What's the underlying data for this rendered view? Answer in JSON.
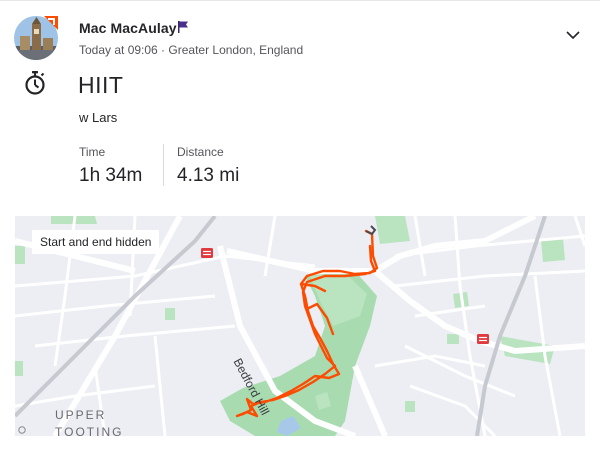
{
  "athlete": {
    "name": "Mac MacAulay",
    "avatar_icon": "avatar-photo",
    "badge_icon": "strava-badge-icon",
    "flag_icon": "flag-icon",
    "meta": "Today at 09:06 · Greater London, England"
  },
  "controls": {
    "expand_icon": "chevron-down-icon"
  },
  "activity": {
    "type_icon": "stopwatch-icon",
    "title": "HIIT",
    "description": "w Lars"
  },
  "stats": [
    {
      "label": "Time",
      "value": "1h 34m"
    },
    {
      "label": "Distance",
      "value": "4.13 mi"
    }
  ],
  "map": {
    "note": "Start and end hidden",
    "place_label_line1": "UPPER",
    "place_label_line2": "TOOTING",
    "road_label": "Bedford Hill",
    "route_color": "#fc4c02",
    "park_color": "#a8dcb0",
    "rail_icon": "rail-station-icon"
  },
  "colors": {
    "text": "#242428",
    "muted": "#55555c",
    "accent": "#fc4c02"
  }
}
